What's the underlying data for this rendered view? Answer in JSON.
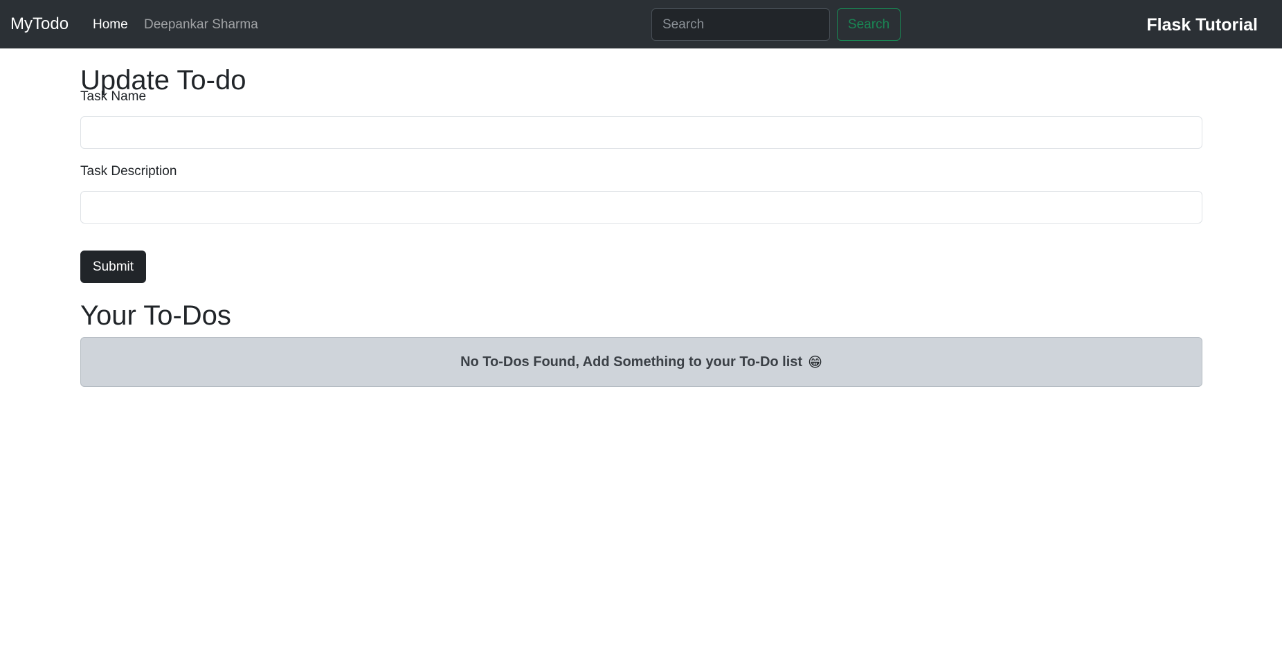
{
  "navbar": {
    "brand": "MyTodo",
    "links": [
      {
        "label": "Home"
      },
      {
        "label": "Deepankar Sharma"
      }
    ],
    "search": {
      "placeholder": "Search",
      "value": "",
      "button_label": "Search"
    },
    "title": "Flask Tutorial"
  },
  "form": {
    "title": "Update To-do",
    "task_name": {
      "label": "Task Name",
      "value": ""
    },
    "task_description": {
      "label": "Task Description",
      "value": ""
    },
    "submit_label": "Submit"
  },
  "todos": {
    "title": "Your To-Dos",
    "empty_message": "No To-Dos Found, Add Something to your To-Do list",
    "empty_emoji": "😁"
  },
  "colors": {
    "navbar_bg": "#2b3035",
    "search_button": "#198754",
    "submit_bg": "#212529",
    "alert_bg": "#cfd4da"
  }
}
